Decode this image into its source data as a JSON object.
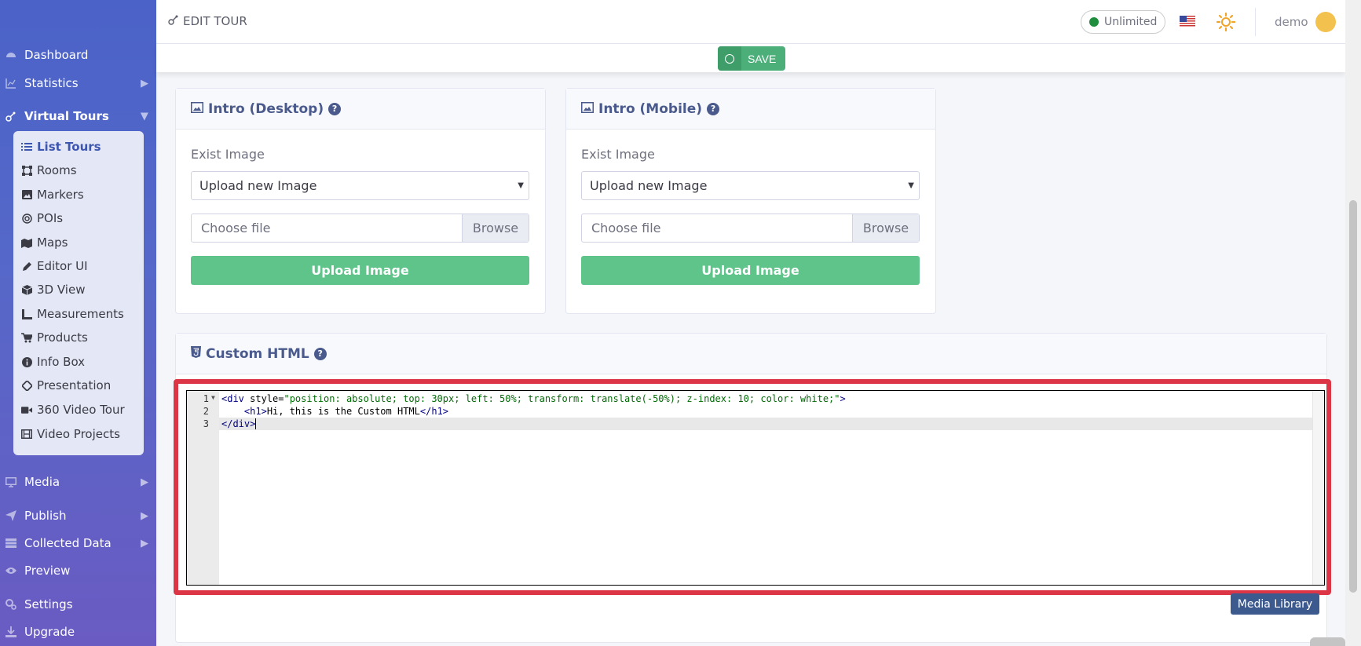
{
  "topbar": {
    "title": "EDIT TOUR",
    "plan_badge": "Unlimited",
    "user_name": "demo",
    "language_flag": "us-flag-icon",
    "theme_icon": "sun-icon"
  },
  "savebar": {
    "save_label": "SAVE"
  },
  "sidebar": {
    "items": [
      {
        "label": "Dashboard",
        "icon": "dashboard-icon"
      },
      {
        "label": "Statistics",
        "icon": "chart-icon"
      },
      {
        "label": "Virtual Tours",
        "icon": "tour-icon"
      },
      {
        "label": "Media",
        "icon": "monitor-icon"
      },
      {
        "label": "Publish",
        "icon": "send-icon"
      },
      {
        "label": "Collected Data",
        "icon": "table-icon"
      },
      {
        "label": "Preview",
        "icon": "eye-icon"
      },
      {
        "label": "Settings",
        "icon": "gears-icon"
      },
      {
        "label": "Upgrade",
        "icon": "download-icon"
      }
    ],
    "submenu": [
      {
        "label": "List Tours",
        "icon": "list-icon"
      },
      {
        "label": "Rooms",
        "icon": "vector-square-icon"
      },
      {
        "label": "Markers",
        "icon": "image-icon"
      },
      {
        "label": "POIs",
        "icon": "bullseye-icon"
      },
      {
        "label": "Maps",
        "icon": "map-icon"
      },
      {
        "label": "Editor UI",
        "icon": "pencil-icon"
      },
      {
        "label": "3D View",
        "icon": "cube-icon"
      },
      {
        "label": "Measurements",
        "icon": "ruler-icon"
      },
      {
        "label": "Products",
        "icon": "cart-icon"
      },
      {
        "label": "Info Box",
        "icon": "info-icon"
      },
      {
        "label": "Presentation",
        "icon": "diamond-icon"
      },
      {
        "label": "360 Video Tour",
        "icon": "video-icon"
      },
      {
        "label": "Video Projects",
        "icon": "film-icon"
      }
    ]
  },
  "intro_desktop": {
    "title": "Intro (Desktop)",
    "exist_label": "Exist Image",
    "select_value": "Upload new Image",
    "file_placeholder": "Choose file",
    "browse_label": "Browse",
    "upload_label": "Upload Image"
  },
  "intro_mobile": {
    "title": "Intro (Mobile)",
    "exist_label": "Exist Image",
    "select_value": "Upload new Image",
    "file_placeholder": "Choose file",
    "browse_label": "Browse",
    "upload_label": "Upload Image"
  },
  "custom_html": {
    "title": "Custom HTML",
    "line_numbers": [
      "1",
      "2",
      "3"
    ],
    "code": {
      "line1_open": "<div",
      "line1_attr": " style=",
      "line1_str": "\"position: absolute; top: 30px; left: 50%; transform: translate(-50%); z-index: 10; color: white;\"",
      "line1_close": ">",
      "line2_indent": "    ",
      "line2_open": "<h1>",
      "line2_text": "Hi, this is the Custom HTML",
      "line2_close": "</h1>",
      "line3": "</div>"
    },
    "media_library_label": "Media Library"
  },
  "colors": {
    "sidebar_top": "#4b62c8",
    "sidebar_bottom": "#6a5bc2",
    "save_green": "#4caf7a",
    "upload_green": "#5ec48a",
    "highlight_red": "#dc3545",
    "heading_blue": "#4a5a8c"
  }
}
